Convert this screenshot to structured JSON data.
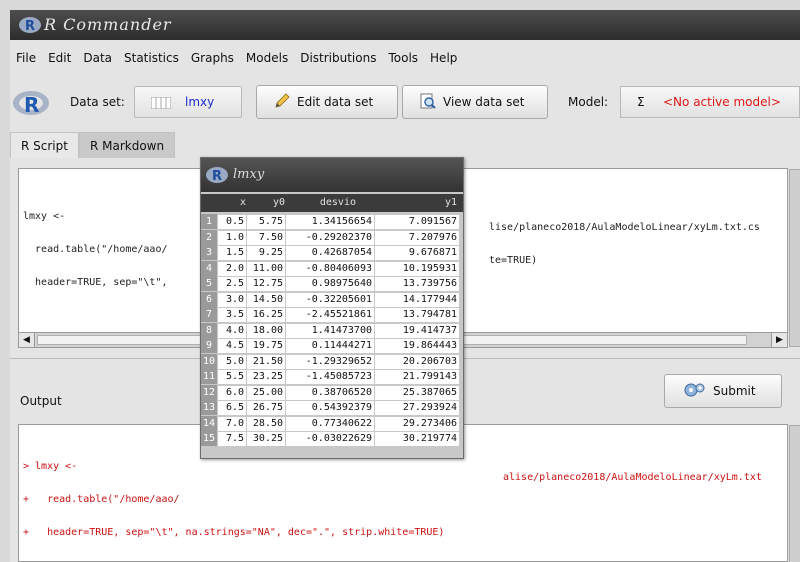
{
  "window": {
    "title": "R Commander"
  },
  "menu": [
    "File",
    "Edit",
    "Data",
    "Statistics",
    "Graphs",
    "Models",
    "Distributions",
    "Tools",
    "Help"
  ],
  "toolbar": {
    "dataset_label": "Data set:",
    "dataset_value": "lmxy",
    "edit_label": "Edit data set",
    "view_label": "View data set",
    "model_label": "Model:",
    "model_sigma": "Σ",
    "model_value": "<No active model>"
  },
  "tabs": [
    "R Script",
    "R Markdown"
  ],
  "script": {
    "lines": [
      "lmxy <-",
      "  read.table(\"/home/aao/",
      "  header=TRUE, sep=\"\\t\","
    ],
    "lines_right": [
      "lise/planeco2018/AulaModeloLinear/xyLm.txt.cs",
      "te=TRUE)"
    ]
  },
  "output": {
    "label": "Output",
    "submit_label": "Submit",
    "lines": [
      "> lmxy <-",
      "+   read.table(\"/home/aao/",
      "+   header=TRUE, sep=\"\\t\", na.strings=\"NA\", dec=\".\", strip.white=TRUE)"
    ],
    "lines_right": [
      "alise/planeco2018/AulaModeloLinear/xyLm.txt"
    ]
  },
  "popup": {
    "title": "lmxy",
    "columns": [
      "x",
      "y0",
      "desvio",
      "y1"
    ],
    "rows": [
      [
        "1",
        "0.5",
        "5.75",
        "1.34156654",
        "7.091567"
      ],
      [
        "2",
        "1.0",
        "7.50",
        "-0.29202370",
        "7.207976"
      ],
      [
        "3",
        "1.5",
        "9.25",
        "0.42687054",
        "9.676871"
      ],
      [
        "4",
        "2.0",
        "11.00",
        "-0.80406093",
        "10.195931"
      ],
      [
        "5",
        "2.5",
        "12.75",
        "0.98975640",
        "13.739756"
      ],
      [
        "6",
        "3.0",
        "14.50",
        "-0.32205601",
        "14.177944"
      ],
      [
        "7",
        "3.5",
        "16.25",
        "-2.45521861",
        "13.794781"
      ],
      [
        "8",
        "4.0",
        "18.00",
        "1.41473700",
        "19.414737"
      ],
      [
        "9",
        "4.5",
        "19.75",
        "0.11444271",
        "19.864443"
      ],
      [
        "10",
        "5.0",
        "21.50",
        "-1.29329652",
        "20.206703"
      ],
      [
        "11",
        "5.5",
        "23.25",
        "-1.45085723",
        "21.799143"
      ],
      [
        "12",
        "6.0",
        "25.00",
        "0.38706520",
        "25.387065"
      ],
      [
        "13",
        "6.5",
        "26.75",
        "0.54392379",
        "27.293924"
      ],
      [
        "14",
        "7.0",
        "28.50",
        "0.77340622",
        "29.273406"
      ],
      [
        "15",
        "7.5",
        "30.25",
        "-0.03022629",
        "30.219774"
      ]
    ]
  },
  "colors": {
    "dataset_value": "#1c2bd6",
    "model_value": "#e01818",
    "output_text": "#cc1111"
  }
}
